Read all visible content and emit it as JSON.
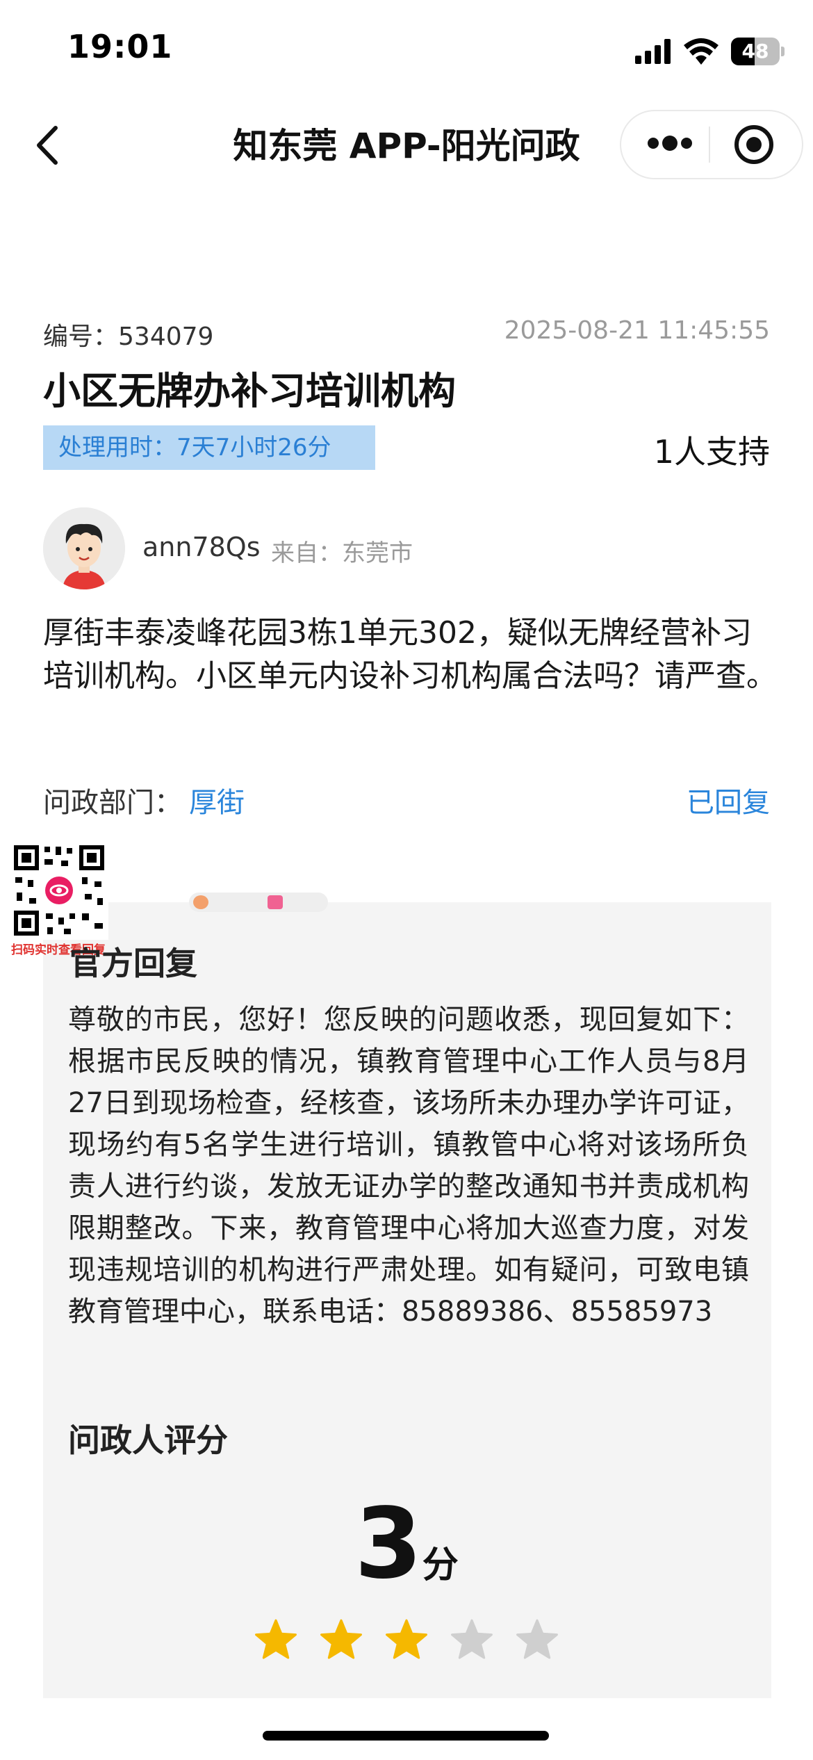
{
  "status_bar": {
    "time": "19:01",
    "battery": "48"
  },
  "nav": {
    "title": "知东莞 APP-阳光问政"
  },
  "post": {
    "code_label": "编号：",
    "code": "534079",
    "date": "2025-08-21 11:45:55",
    "title": "小区无牌办补习培训机构",
    "duration_label": "处理用时：",
    "duration": "7天7小时26分",
    "supporters": "1人支持",
    "user": "ann78Qs",
    "from_label": "来自：",
    "from": "东莞市",
    "content": "厚街丰泰凌峰花园3栋1单元302，疑似无牌经营补习培训机构。小区单元内设补习机构属合法吗？请严查。",
    "department_label": "问政部门：",
    "department": "厚街",
    "reply_status": "已回复"
  },
  "watermark": {
    "qr_caption": "扫码实时查看回复"
  },
  "reply": {
    "title": "官方回复",
    "text": "尊敬的市民，您好！您反映的问题收悉，现回复如下：根据市民反映的情况，镇教育管理中心工作人员与8月27日到现场检查，经核查，该场所未办理办学许可证，现场约有5名学生进行培训，镇教管中心将对该场所负责人进行约谈，发放无证办学的整改通知书并责成机构限期整改。下来，教育管理中心将加大巡查力度，对发现违规培训的机构进行严肃处理。如有疑问，可致电镇教育管理中心，联系电话：85889386、85585973"
  },
  "rating": {
    "title": "问政人评分",
    "score": "3",
    "unit": "分",
    "stars_filled": 3,
    "stars_total": 5
  },
  "colors": {
    "accent_blue": "#2a85db",
    "badge_bg": "#b7d8f5",
    "star_on": "#f5b800",
    "star_off": "#cfcfcf",
    "card_bg": "#f4f4f4"
  }
}
